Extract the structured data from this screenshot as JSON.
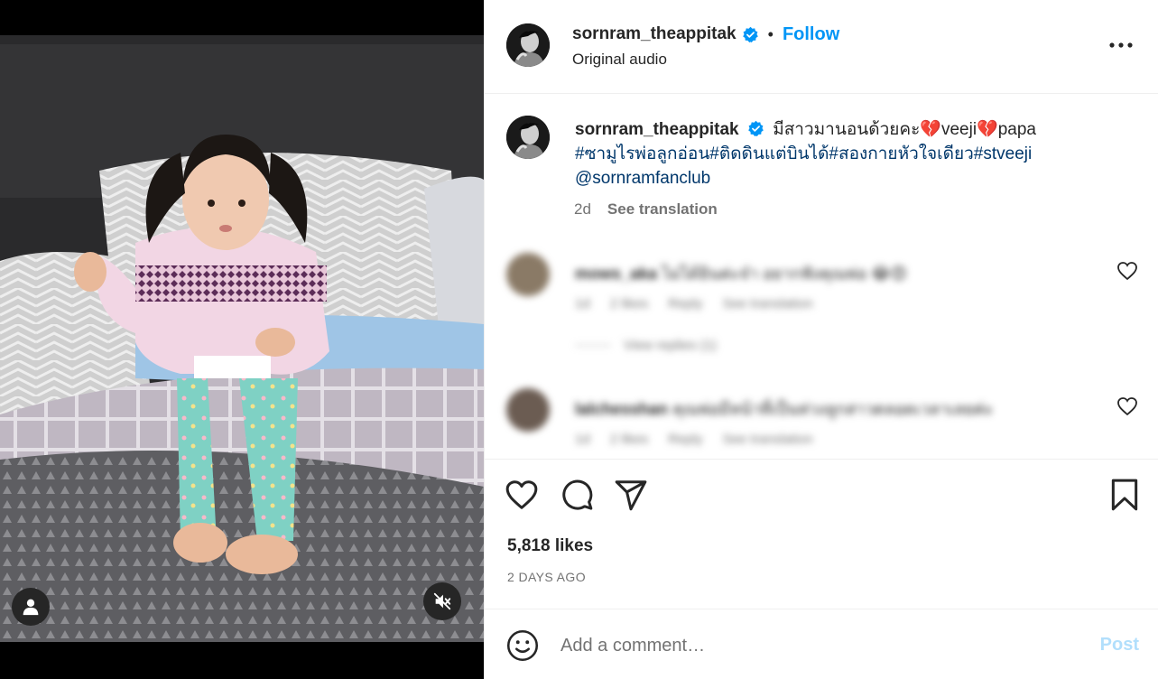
{
  "post": {
    "author": "sornram_theappitak",
    "verified": true,
    "follow_label": "Follow",
    "separator": "•",
    "audio_label": "Original audio"
  },
  "caption": {
    "author": "sornram_theappitak",
    "text_part1": "มีสาวมานอนด้วยคะ",
    "heart1": "💔",
    "text_part2": "veeji",
    "heart2": "💔",
    "text_part3": "papa",
    "hashtags": "#ซามูไรพ่อลูกอ่อน#ติดดินแต่บินได้#สองกายหัวใจเดียว#stveeji",
    "mention": "@sornramfanclub",
    "age": "2d",
    "see_translation": "See translation"
  },
  "comments": [
    {
      "username": "mows_aka",
      "text": "ไม่ได้ยินค่ะจ๋า อยากฟังคุณพ่อ",
      "emojis": "😂😍",
      "age": "1d",
      "likes": "2 likes",
      "reply": "Reply",
      "see_translation": "See translation",
      "view_replies": "View replies (1)"
    },
    {
      "username": "lalchesshan",
      "text": "คุณพ่อมีหน้าที่เป็นห่วงลูกสาวตลอดเวลาเลยค่ะ",
      "age": "1d",
      "likes": "2 likes",
      "reply": "Reply",
      "see_translation": "See translation"
    }
  ],
  "actions": {
    "likes": "5,818 likes",
    "timestamp": "2 DAYS AGO"
  },
  "add_comment": {
    "placeholder": "Add a comment…",
    "post_label": "Post"
  },
  "icons": {
    "more": "more-options-icon",
    "like": "heart-icon",
    "comment": "comment-icon",
    "share": "share-icon",
    "save": "bookmark-icon",
    "emoji": "emoji-icon",
    "tags": "user-tag-icon",
    "mute": "muted-speaker-icon"
  },
  "colors": {
    "accent": "#0095f6",
    "hashtag": "#00376b",
    "secondary_text": "#737373",
    "post_disabled": "#b2dffc"
  }
}
